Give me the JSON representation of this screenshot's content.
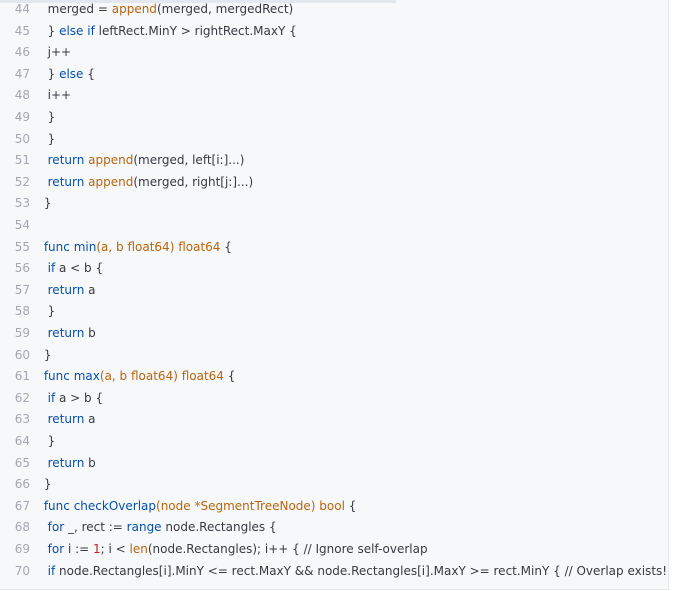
{
  "editor": {
    "colors": {
      "background": "#f7f8fa",
      "line_number": "#a3a7b0",
      "text": "#383a42",
      "keyword": "#0550ae",
      "builtin": "#b8650d",
      "type": "#b8650d",
      "number": "#c5221f"
    },
    "lines": [
      {
        "num": "44",
        "parts": [
          {
            "t": "  merged = ",
            "c": "text"
          },
          {
            "t": "append",
            "c": "fn"
          },
          {
            "t": "(merged, mergedRect)",
            "c": "text"
          }
        ]
      },
      {
        "num": "45",
        "parts": [
          {
            "t": "  } ",
            "c": "text"
          },
          {
            "t": "else if",
            "c": "kw"
          },
          {
            "t": " leftRect.MinY > rightRect.MaxY {",
            "c": "text"
          }
        ]
      },
      {
        "num": "46",
        "parts": [
          {
            "t": "  j++",
            "c": "text"
          }
        ]
      },
      {
        "num": "47",
        "parts": [
          {
            "t": "  } ",
            "c": "text"
          },
          {
            "t": "else",
            "c": "kw"
          },
          {
            "t": " {",
            "c": "text"
          }
        ]
      },
      {
        "num": "48",
        "parts": [
          {
            "t": "  i++",
            "c": "text"
          }
        ]
      },
      {
        "num": "49",
        "parts": [
          {
            "t": "  }",
            "c": "text"
          }
        ]
      },
      {
        "num": "50",
        "parts": [
          {
            "t": "  }",
            "c": "text"
          }
        ]
      },
      {
        "num": "51",
        "parts": [
          {
            "t": "  ",
            "c": "text"
          },
          {
            "t": "return",
            "c": "kw"
          },
          {
            "t": " ",
            "c": "text"
          },
          {
            "t": "append",
            "c": "fn"
          },
          {
            "t": "(merged, left[i:]...)",
            "c": "text"
          }
        ]
      },
      {
        "num": "52",
        "parts": [
          {
            "t": "  ",
            "c": "text"
          },
          {
            "t": "return",
            "c": "kw"
          },
          {
            "t": " ",
            "c": "text"
          },
          {
            "t": "append",
            "c": "fn"
          },
          {
            "t": "(merged, right[j:]...)",
            "c": "text"
          }
        ]
      },
      {
        "num": "53",
        "parts": [
          {
            "t": " }",
            "c": "text"
          }
        ]
      },
      {
        "num": "54",
        "parts": []
      },
      {
        "num": "55",
        "parts": [
          {
            "t": " ",
            "c": "text"
          },
          {
            "t": "func",
            "c": "kw"
          },
          {
            "t": " ",
            "c": "text"
          },
          {
            "t": "min",
            "c": "kw"
          },
          {
            "t": "(a, b ",
            "c": "ty"
          },
          {
            "t": "float64",
            "c": "ty"
          },
          {
            "t": ") ",
            "c": "ty"
          },
          {
            "t": "float64",
            "c": "ty"
          },
          {
            "t": " {",
            "c": "text"
          }
        ]
      },
      {
        "num": "56",
        "parts": [
          {
            "t": "  ",
            "c": "text"
          },
          {
            "t": "if",
            "c": "kw"
          },
          {
            "t": " a < b {",
            "c": "text"
          }
        ]
      },
      {
        "num": "57",
        "parts": [
          {
            "t": "  ",
            "c": "text"
          },
          {
            "t": "return",
            "c": "kw"
          },
          {
            "t": " a",
            "c": "text"
          }
        ]
      },
      {
        "num": "58",
        "parts": [
          {
            "t": "  }",
            "c": "text"
          }
        ]
      },
      {
        "num": "59",
        "parts": [
          {
            "t": "  ",
            "c": "text"
          },
          {
            "t": "return",
            "c": "kw"
          },
          {
            "t": " b",
            "c": "text"
          }
        ]
      },
      {
        "num": "60",
        "parts": [
          {
            "t": " }",
            "c": "text"
          }
        ]
      },
      {
        "num": "61",
        "parts": [
          {
            "t": " ",
            "c": "text"
          },
          {
            "t": "func",
            "c": "kw"
          },
          {
            "t": " ",
            "c": "text"
          },
          {
            "t": "max",
            "c": "kw"
          },
          {
            "t": "(a, b ",
            "c": "ty"
          },
          {
            "t": "float64",
            "c": "ty"
          },
          {
            "t": ") ",
            "c": "ty"
          },
          {
            "t": "float64",
            "c": "ty"
          },
          {
            "t": " {",
            "c": "text"
          }
        ]
      },
      {
        "num": "62",
        "parts": [
          {
            "t": "  ",
            "c": "text"
          },
          {
            "t": "if",
            "c": "kw"
          },
          {
            "t": " a > b {",
            "c": "text"
          }
        ]
      },
      {
        "num": "63",
        "parts": [
          {
            "t": "  ",
            "c": "text"
          },
          {
            "t": "return",
            "c": "kw"
          },
          {
            "t": " a",
            "c": "text"
          }
        ]
      },
      {
        "num": "64",
        "parts": [
          {
            "t": "  }",
            "c": "text"
          }
        ]
      },
      {
        "num": "65",
        "parts": [
          {
            "t": "  ",
            "c": "text"
          },
          {
            "t": "return",
            "c": "kw"
          },
          {
            "t": " b",
            "c": "text"
          }
        ]
      },
      {
        "num": "66",
        "parts": [
          {
            "t": " }",
            "c": "text"
          }
        ]
      },
      {
        "num": "67",
        "parts": [
          {
            "t": " ",
            "c": "text"
          },
          {
            "t": "func",
            "c": "kw"
          },
          {
            "t": " ",
            "c": "text"
          },
          {
            "t": "checkOverlap",
            "c": "kw"
          },
          {
            "t": "(node *SegmentTreeNode) ",
            "c": "ty"
          },
          {
            "t": "bool",
            "c": "ty"
          },
          {
            "t": " {",
            "c": "text"
          }
        ]
      },
      {
        "num": "68",
        "parts": [
          {
            "t": "  ",
            "c": "text"
          },
          {
            "t": "for",
            "c": "kw"
          },
          {
            "t": " _, rect := ",
            "c": "text"
          },
          {
            "t": "range",
            "c": "kw"
          },
          {
            "t": " node.Rectangles {",
            "c": "text"
          }
        ]
      },
      {
        "num": "69",
        "parts": [
          {
            "t": "  ",
            "c": "text"
          },
          {
            "t": "for",
            "c": "kw"
          },
          {
            "t": " i := ",
            "c": "text"
          },
          {
            "t": "1",
            "c": "num"
          },
          {
            "t": "; i < ",
            "c": "text"
          },
          {
            "t": "len",
            "c": "fn"
          },
          {
            "t": "(node.Rectangles); i++ { // Ignore self-overlap",
            "c": "text"
          }
        ]
      },
      {
        "num": "70",
        "parts": [
          {
            "t": "  ",
            "c": "text"
          },
          {
            "t": "if",
            "c": "kw"
          },
          {
            "t": " node.Rectangles[i].MinY <= rect.MaxY && node.Rectangles[i].MaxY >= rect.MinY { // Overlap exists! (No",
            "c": "text"
          }
        ]
      }
    ]
  }
}
